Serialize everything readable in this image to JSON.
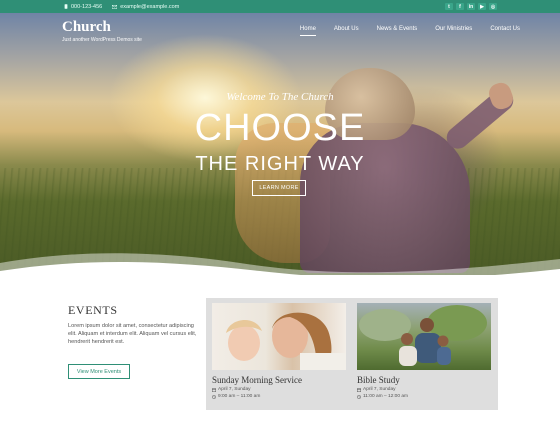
{
  "topbar": {
    "phone": "000-123-456",
    "email": "example@example.com",
    "socials": [
      "twitter-icon",
      "facebook-icon",
      "linkedin-icon",
      "youtube-icon",
      "instagram-icon"
    ]
  },
  "brand": {
    "name": "Church",
    "tagline": "Just another WordPress Demos site"
  },
  "nav": {
    "items": [
      "Home",
      "About Us",
      "News & Events",
      "Our Ministries",
      "Contact Us"
    ],
    "active": "Home"
  },
  "hero": {
    "welcome": "Welcome To The Church",
    "headline": "CHOOSE",
    "subheadline": "THE RIGHT WAY",
    "button": "LEARN MORE"
  },
  "events": {
    "title": "EVENTS",
    "text": "Lorem ipsum dolor sit amet, consectetur adipiscing elit. Aliquam et interdum elit. Aliquam vel cursus elit, hendrerit hendrerit est.",
    "button": "View More Events",
    "cards": [
      {
        "title": "Sunday Morning Service",
        "date": "April 7, Sunday",
        "time": "9:00 am – 11:00 am"
      },
      {
        "title": "Bible Study",
        "date": "April 7, Sunday",
        "time": "11:00 am – 12:00 am"
      }
    ]
  },
  "colors": {
    "accent": "#2f8f76",
    "card_bg": "#dedede"
  }
}
